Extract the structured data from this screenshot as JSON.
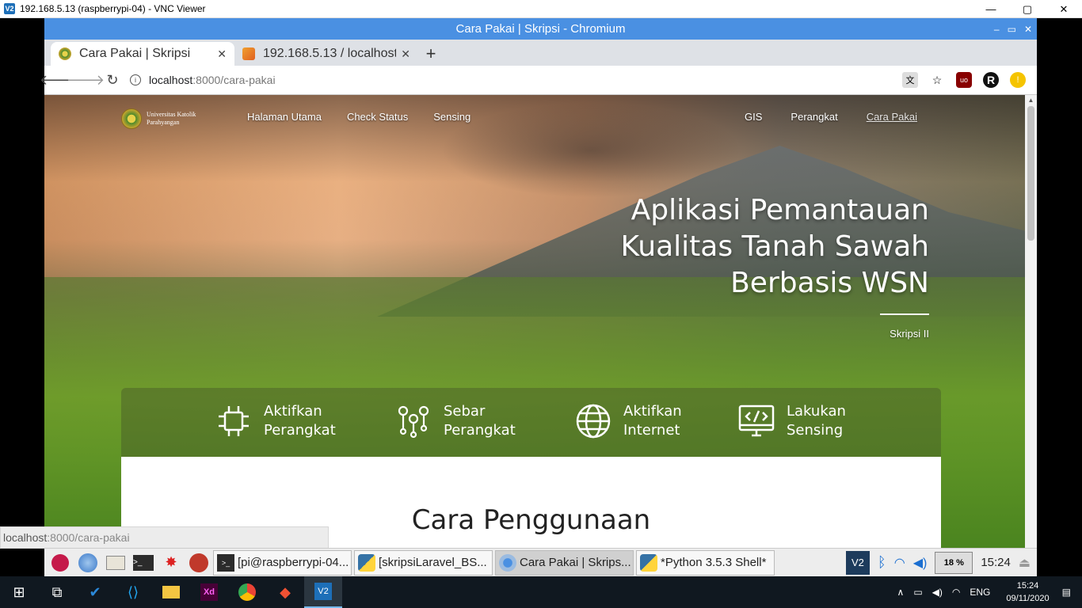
{
  "vnc": {
    "title": "192.168.5.13 (raspberrypi-04) - VNC Viewer",
    "logo": "V2",
    "controls": {
      "minimize": "—",
      "maximize": "▢",
      "close": "✕"
    }
  },
  "chromium": {
    "window_title": "Cara Pakai | Skripsi - Chromium",
    "tabs": [
      {
        "label": "Cara Pakai | Skripsi",
        "icon": "university-seal-icon"
      },
      {
        "label": "192.168.5.13 / localhost",
        "icon": "phpmyadmin-icon"
      }
    ],
    "new_tab": "+",
    "url_host": "localhost",
    "url_path": ":8000/cara-pakai"
  },
  "site": {
    "logo_text": "Universitas Katolik Parahyangan",
    "nav_left": [
      "Halaman Utama",
      "Check Status",
      "Sensing"
    ],
    "nav_right": [
      "GIS",
      "Perangkat",
      "Cara Pakai"
    ],
    "hero_line1": "Aplikasi Pemantauan",
    "hero_line2": "Kualitas Tanah Sawah",
    "hero_line3": "Berbasis WSN",
    "hero_subtitle": "Skripsi II",
    "features": [
      {
        "line1": "Aktifkan",
        "line2": "Perangkat",
        "icon": "chip-icon"
      },
      {
        "line1": "Sebar",
        "line2": "Perangkat",
        "icon": "location-pins-icon"
      },
      {
        "line1": "Aktifkan",
        "line2": "Internet",
        "icon": "globe-icon"
      },
      {
        "line1": "Lakukan",
        "line2": "Sensing",
        "icon": "code-monitor-icon"
      }
    ],
    "section_title": "Cara Penggunaan"
  },
  "status_link": {
    "host": "localhost",
    "path": ":8000/cara-pakai"
  },
  "pi_taskbar": {
    "tasks": [
      {
        "label": "[pi@raspberrypi-04...",
        "icon": "terminal-icon"
      },
      {
        "label": "[skripsiLaravel_BS...",
        "icon": "python-icon"
      },
      {
        "label": "Cara Pakai | Skrips...",
        "icon": "chromium-icon"
      },
      {
        "label": "*Python 3.5.3 Shell*",
        "icon": "python-icon"
      }
    ],
    "cpu": "18 %",
    "time": "15:24"
  },
  "windows_taskbar": {
    "language": "ENG",
    "time": "15:24",
    "date": "09/11/2020"
  },
  "colors": {
    "chromium_titlebar": "#4a90e2",
    "tabstrip": "#dee1e6",
    "win_taskbar": "#101820"
  }
}
